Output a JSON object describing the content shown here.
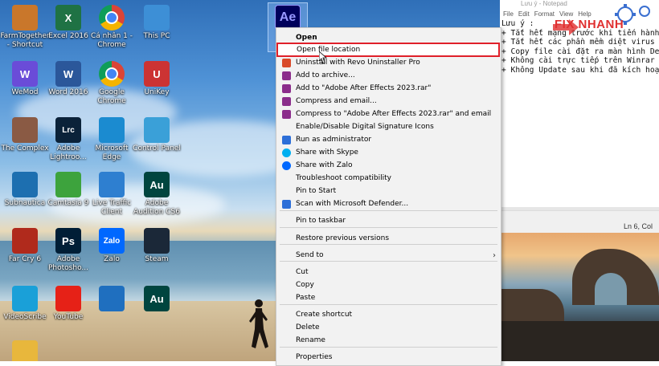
{
  "desktop_icons": [
    {
      "label": "FarmTogether - Shortcut",
      "icon": "farmtogether-icon",
      "color": "#c9772b"
    },
    {
      "label": "Excel 2016",
      "icon": "excel-icon",
      "color": "#1f7244",
      "glyph": "X"
    },
    {
      "label": "Cá nhân 1 - Chrome",
      "icon": "chrome-icon",
      "color": "#db4437"
    },
    {
      "label": "This PC",
      "icon": "this-pc-icon",
      "color": "#3d8fd6"
    },
    {
      "label": "WeMod",
      "icon": "wemod-icon",
      "color": "#6a4cd8",
      "glyph": "W"
    },
    {
      "label": "Word 2016",
      "icon": "word-icon",
      "color": "#2b579a",
      "glyph": "W"
    },
    {
      "label": "Google Chrome",
      "icon": "chrome-icon",
      "color": "#db4437"
    },
    {
      "label": "UniKey",
      "icon": "unikey-icon",
      "color": "#cc3333",
      "glyph": "U"
    },
    {
      "label": "The Complex",
      "icon": "the-complex-icon",
      "color": "#8a5a44"
    },
    {
      "label": "Adobe Lightroo...",
      "icon": "lightroom-icon",
      "color": "#0b2239",
      "glyph": "Lrc"
    },
    {
      "label": "Microsoft Edge",
      "icon": "edge-icon",
      "color": "#1b8bd0"
    },
    {
      "label": "Control Panel",
      "icon": "control-panel-icon",
      "color": "#3aa0d8"
    },
    {
      "label": "Subnautica",
      "icon": "subnautica-icon",
      "color": "#1d6fb0"
    },
    {
      "label": "Camtasia 9",
      "icon": "camtasia-icon",
      "color": "#3da33d"
    },
    {
      "label": "Live Traffic Client",
      "icon": "live-traffic-icon",
      "color": "#2e7fd0"
    },
    {
      "label": "Adobe Audition CS6",
      "icon": "audition-icon",
      "color": "#00453f",
      "glyph": "Au"
    },
    {
      "label": "Far Cry 6",
      "icon": "farcry-icon",
      "color": "#b02a1c"
    },
    {
      "label": "Adobe Photosho...",
      "icon": "photoshop-icon",
      "color": "#001e36",
      "glyph": "Ps"
    },
    {
      "label": "Zalo",
      "icon": "zalo-icon",
      "color": "#0068ff",
      "glyph": "Zalo"
    },
    {
      "label": "Steam",
      "icon": "steam-icon",
      "color": "#1b2838"
    },
    {
      "label": "VideoScribe",
      "icon": "videoscribe-icon",
      "color": "#1aa0d8"
    },
    {
      "label": "YouTube",
      "icon": "youtube-icon",
      "color": "#e62117"
    },
    {
      "label": "",
      "icon": "browser-icon",
      "color": "#1f6fbf"
    },
    {
      "label": "",
      "icon": "audition-icon",
      "color": "#00453f",
      "glyph": "Au"
    },
    {
      "label": "",
      "icon": "folder-icon",
      "color": "#e8b73c"
    }
  ],
  "selected_icon": {
    "glyph": "Ae",
    "label": "Adobe After Effects",
    "color": "#00005b"
  },
  "context_menu": {
    "items": [
      {
        "label": "Open",
        "bold": true,
        "icon": ""
      },
      {
        "label": "Open file location",
        "highlighted": true,
        "icon": ""
      },
      {
        "label": "Uninstall with Revo Uninstaller Pro",
        "icon": "revo-icon"
      },
      {
        "label": "Add to archive...",
        "icon": "winrar-icon"
      },
      {
        "label": "Add to \"Adobe After Effects 2023.rar\"",
        "icon": "winrar-icon"
      },
      {
        "label": "Compress and email...",
        "icon": "winrar-icon"
      },
      {
        "label": "Compress to \"Adobe After Effects 2023.rar\" and email",
        "icon": "winrar-icon"
      },
      {
        "label": "Enable/Disable Digital Signature Icons",
        "icon": ""
      },
      {
        "label": "Run as administrator",
        "icon": "shield-icon"
      },
      {
        "label": "Share with Skype",
        "icon": "skype-icon"
      },
      {
        "label": "Share with Zalo",
        "icon": "zalo-icon"
      },
      {
        "label": "Troubleshoot compatibility",
        "icon": ""
      },
      {
        "label": "Pin to Start",
        "icon": ""
      },
      {
        "label": "Scan with Microsoft Defender...",
        "icon": "defender-icon"
      },
      {
        "label": "Pin to taskbar",
        "icon": ""
      },
      {
        "label": "Restore previous versions",
        "icon": ""
      },
      {
        "label": "Send to",
        "icon": "",
        "submenu": true
      },
      {
        "label": "Cut",
        "icon": ""
      },
      {
        "label": "Copy",
        "icon": ""
      },
      {
        "label": "Paste",
        "icon": ""
      },
      {
        "label": "Create shortcut",
        "icon": ""
      },
      {
        "label": "Delete",
        "icon": ""
      },
      {
        "label": "Rename",
        "icon": ""
      },
      {
        "label": "Properties",
        "icon": ""
      }
    ],
    "submenu_arrow": "›"
  },
  "notepad": {
    "title": "Lưu ý - Notepad",
    "menu": [
      "File",
      "Edit",
      "Format",
      "View",
      "Help"
    ],
    "lines": [
      "Lưu ý :",
      "+ Tắt hết mạng trước khi tiến hành",
      "+ Tắt hết các phần mềm diệt virus",
      "+ Copy file cài đặt ra màn hình De",
      "+ Không cài trực tiếp trên Winrar",
      "+ Không Update sau khi đã kích hoạ"
    ],
    "status": "Ln 6, Col"
  },
  "brand": {
    "text": "FIX NHANH",
    "color": "#e03030"
  }
}
